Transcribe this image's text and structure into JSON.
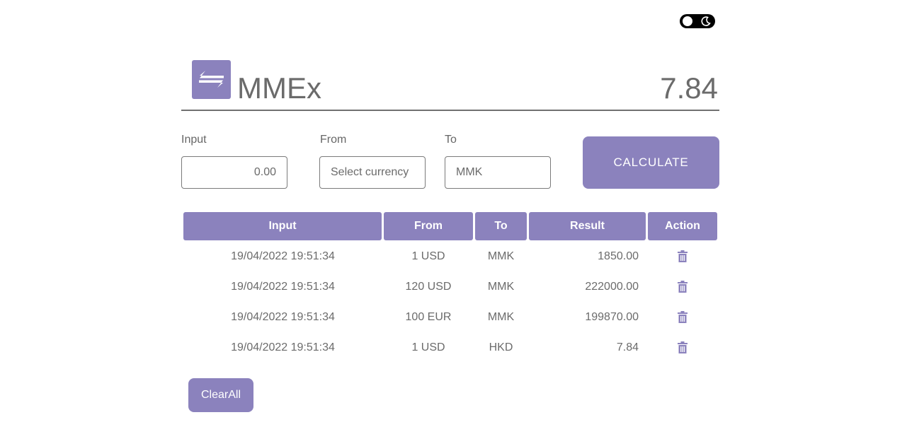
{
  "header": {
    "app_title": "MMEx",
    "result_value": "7.84"
  },
  "form": {
    "input_label": "Input",
    "input_value": "0.00",
    "from_label": "From",
    "from_placeholder": "Select currency",
    "to_label": "To",
    "to_value": "MMK",
    "calculate_label": "CALCULATE"
  },
  "table": {
    "columns": [
      "Input",
      "From",
      "To",
      "Result",
      "Action"
    ],
    "rows": [
      {
        "input": "19/04/2022 19:51:34",
        "from": "1 USD",
        "to": "MMK",
        "result": "1850.00",
        "action_icon": "trash-icon"
      },
      {
        "input": "19/04/2022 19:51:34",
        "from": "120 USD",
        "to": "MMK",
        "result": "222000.00",
        "action_icon": "trash-icon"
      },
      {
        "input": "19/04/2022 19:51:34",
        "from": "100 EUR",
        "to": "MMK",
        "result": "199870.00",
        "action_icon": "trash-icon"
      },
      {
        "input": "19/04/2022 19:51:34",
        "from": "1 USD",
        "to": "HKD",
        "result": "7.84",
        "action_icon": "trash-icon"
      }
    ]
  },
  "clear_all_label": "ClearAll",
  "theme_toggle": {
    "state": "light",
    "icon": "moon-icon"
  },
  "colors": {
    "accent": "#8b82bd",
    "text": "#6b6b6b",
    "toggle_bg": "#000000"
  }
}
